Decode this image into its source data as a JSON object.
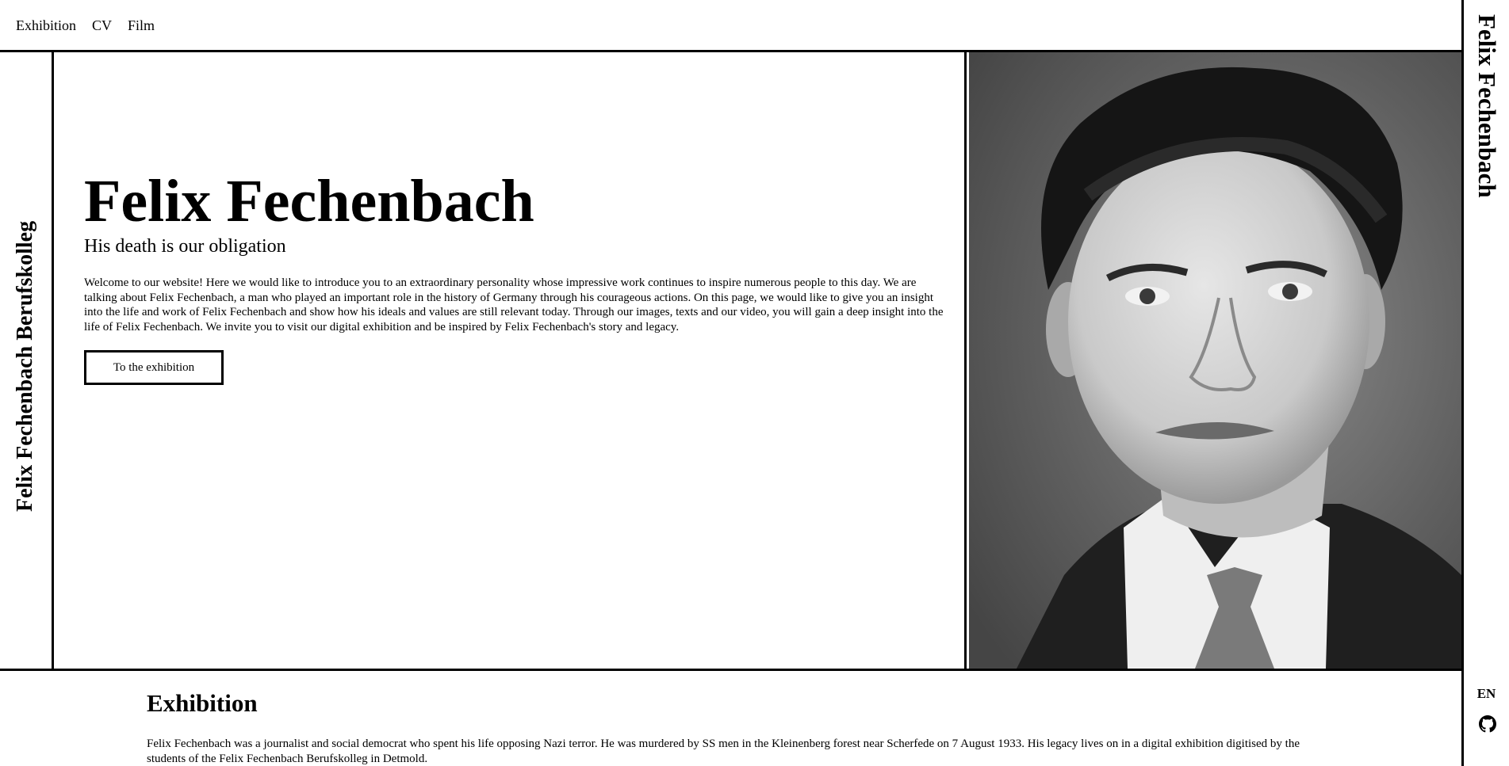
{
  "nav": {
    "items": [
      "Exhibition",
      "CV",
      "Film"
    ]
  },
  "rail": {
    "title": "Felix Fechenbach",
    "lang": "EN",
    "github_icon": "github-icon"
  },
  "hero": {
    "side_label": "Felix Fechenbach Berufskolleg",
    "title": "Felix Fechenbach",
    "subtitle": "His death is our obligation",
    "intro": "Welcome to our website! Here we would like to introduce you to an extraordinary personality whose impressive work continues to inspire numerous people to this day. We are talking about Felix Fechenbach, a man who played an important role in the history of Germany through his courageous actions. On this page, we would like to give you an insight into the life and work of Felix Fechenbach and show how his ideals and values are still relevant today. Through our images, texts and our video, you will gain a deep insight into the life of Felix Fechenbach. We invite you to visit our digital exhibition and be inspired by Felix Fechenbach's story and legacy.",
    "cta": "To the exhibition"
  },
  "exhibition": {
    "heading": "Exhibition",
    "text": "Felix Fechenbach was a journalist and social democrat who spent his life opposing Nazi terror. He was murdered by SS men in the Kleinenberg forest near Scherfede on 7 August 1933. His legacy lives on in a digital exhibition digitised by the students of the Felix Fechenbach Berufskolleg in Detmold."
  }
}
